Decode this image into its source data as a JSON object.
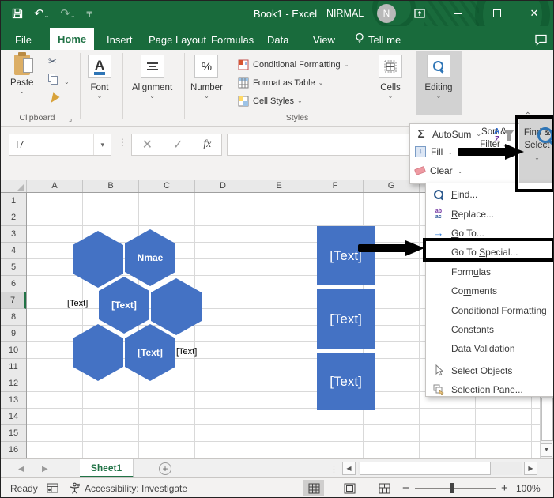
{
  "window": {
    "title": "Book1 - Excel",
    "user": "NIRMAL",
    "avatar": "N"
  },
  "tabs": {
    "file": "File",
    "home": "Home",
    "insert": "Insert",
    "page_layout": "Page Layout",
    "formulas": "Formulas",
    "data": "Data",
    "view": "View",
    "tell_me": "Tell me"
  },
  "ribbon": {
    "paste": "Paste",
    "clipboard": "Clipboard",
    "font": "Font",
    "alignment": "Alignment",
    "number": "Number",
    "conditional_formatting": "Conditional Formatting",
    "format_as_table": "Format as Table",
    "cell_styles": "Cell Styles",
    "styles": "Styles",
    "cells": "Cells",
    "editing": "Editing"
  },
  "formula": {
    "name_box": "I7",
    "fx": "fx"
  },
  "flyout": {
    "autosum": "AutoSum",
    "fill": "Fill",
    "clear": "Clear",
    "sort1": "Sort &",
    "sort2": "Filter",
    "find1": "Find &",
    "find2": "Select"
  },
  "menu": {
    "items": [
      {
        "pre": "",
        "key": "F",
        "post": "ind..."
      },
      {
        "pre": "",
        "key": "R",
        "post": "eplace..."
      },
      {
        "pre": "",
        "key": "G",
        "post": "o To..."
      },
      {
        "pre": "Go To ",
        "key": "S",
        "post": "pecial..."
      },
      {
        "pre": "Form",
        "key": "u",
        "post": "las"
      },
      {
        "pre": "Co",
        "key": "m",
        "post": "ments"
      },
      {
        "pre": "",
        "key": "C",
        "post": "onditional Formatting"
      },
      {
        "pre": "Co",
        "key": "n",
        "post": "stants"
      },
      {
        "pre": "Data ",
        "key": "V",
        "post": "alidation"
      },
      {
        "pre": "Select ",
        "key": "O",
        "post": "bjects"
      },
      {
        "pre": "Selection ",
        "key": "P",
        "post": "ane..."
      }
    ]
  },
  "grid": {
    "columns": [
      "A",
      "B",
      "C",
      "D",
      "E",
      "F",
      "G"
    ],
    "rows": [
      "1",
      "2",
      "3",
      "4",
      "5",
      "6",
      "7",
      "8",
      "9",
      "10",
      "11",
      "12",
      "13",
      "14",
      "15",
      "16"
    ],
    "selected_row": "7"
  },
  "shapes": {
    "hex_name": "Nmae",
    "hex_text_mid": "[Text]",
    "hex_text_bottom": "[Text]",
    "label_left": "[Text]",
    "label_right": "[Text]",
    "rects": [
      "[Text]",
      "[Text]",
      "[Text]"
    ],
    "shape_color": "#4472c4"
  },
  "sheet": {
    "name": "Sheet1"
  },
  "status": {
    "ready": "Ready",
    "accessibility": "Accessibility: Investigate",
    "zoom": "100%"
  },
  "colors": {
    "accent_green": "#217346",
    "annotation": "#000000"
  }
}
